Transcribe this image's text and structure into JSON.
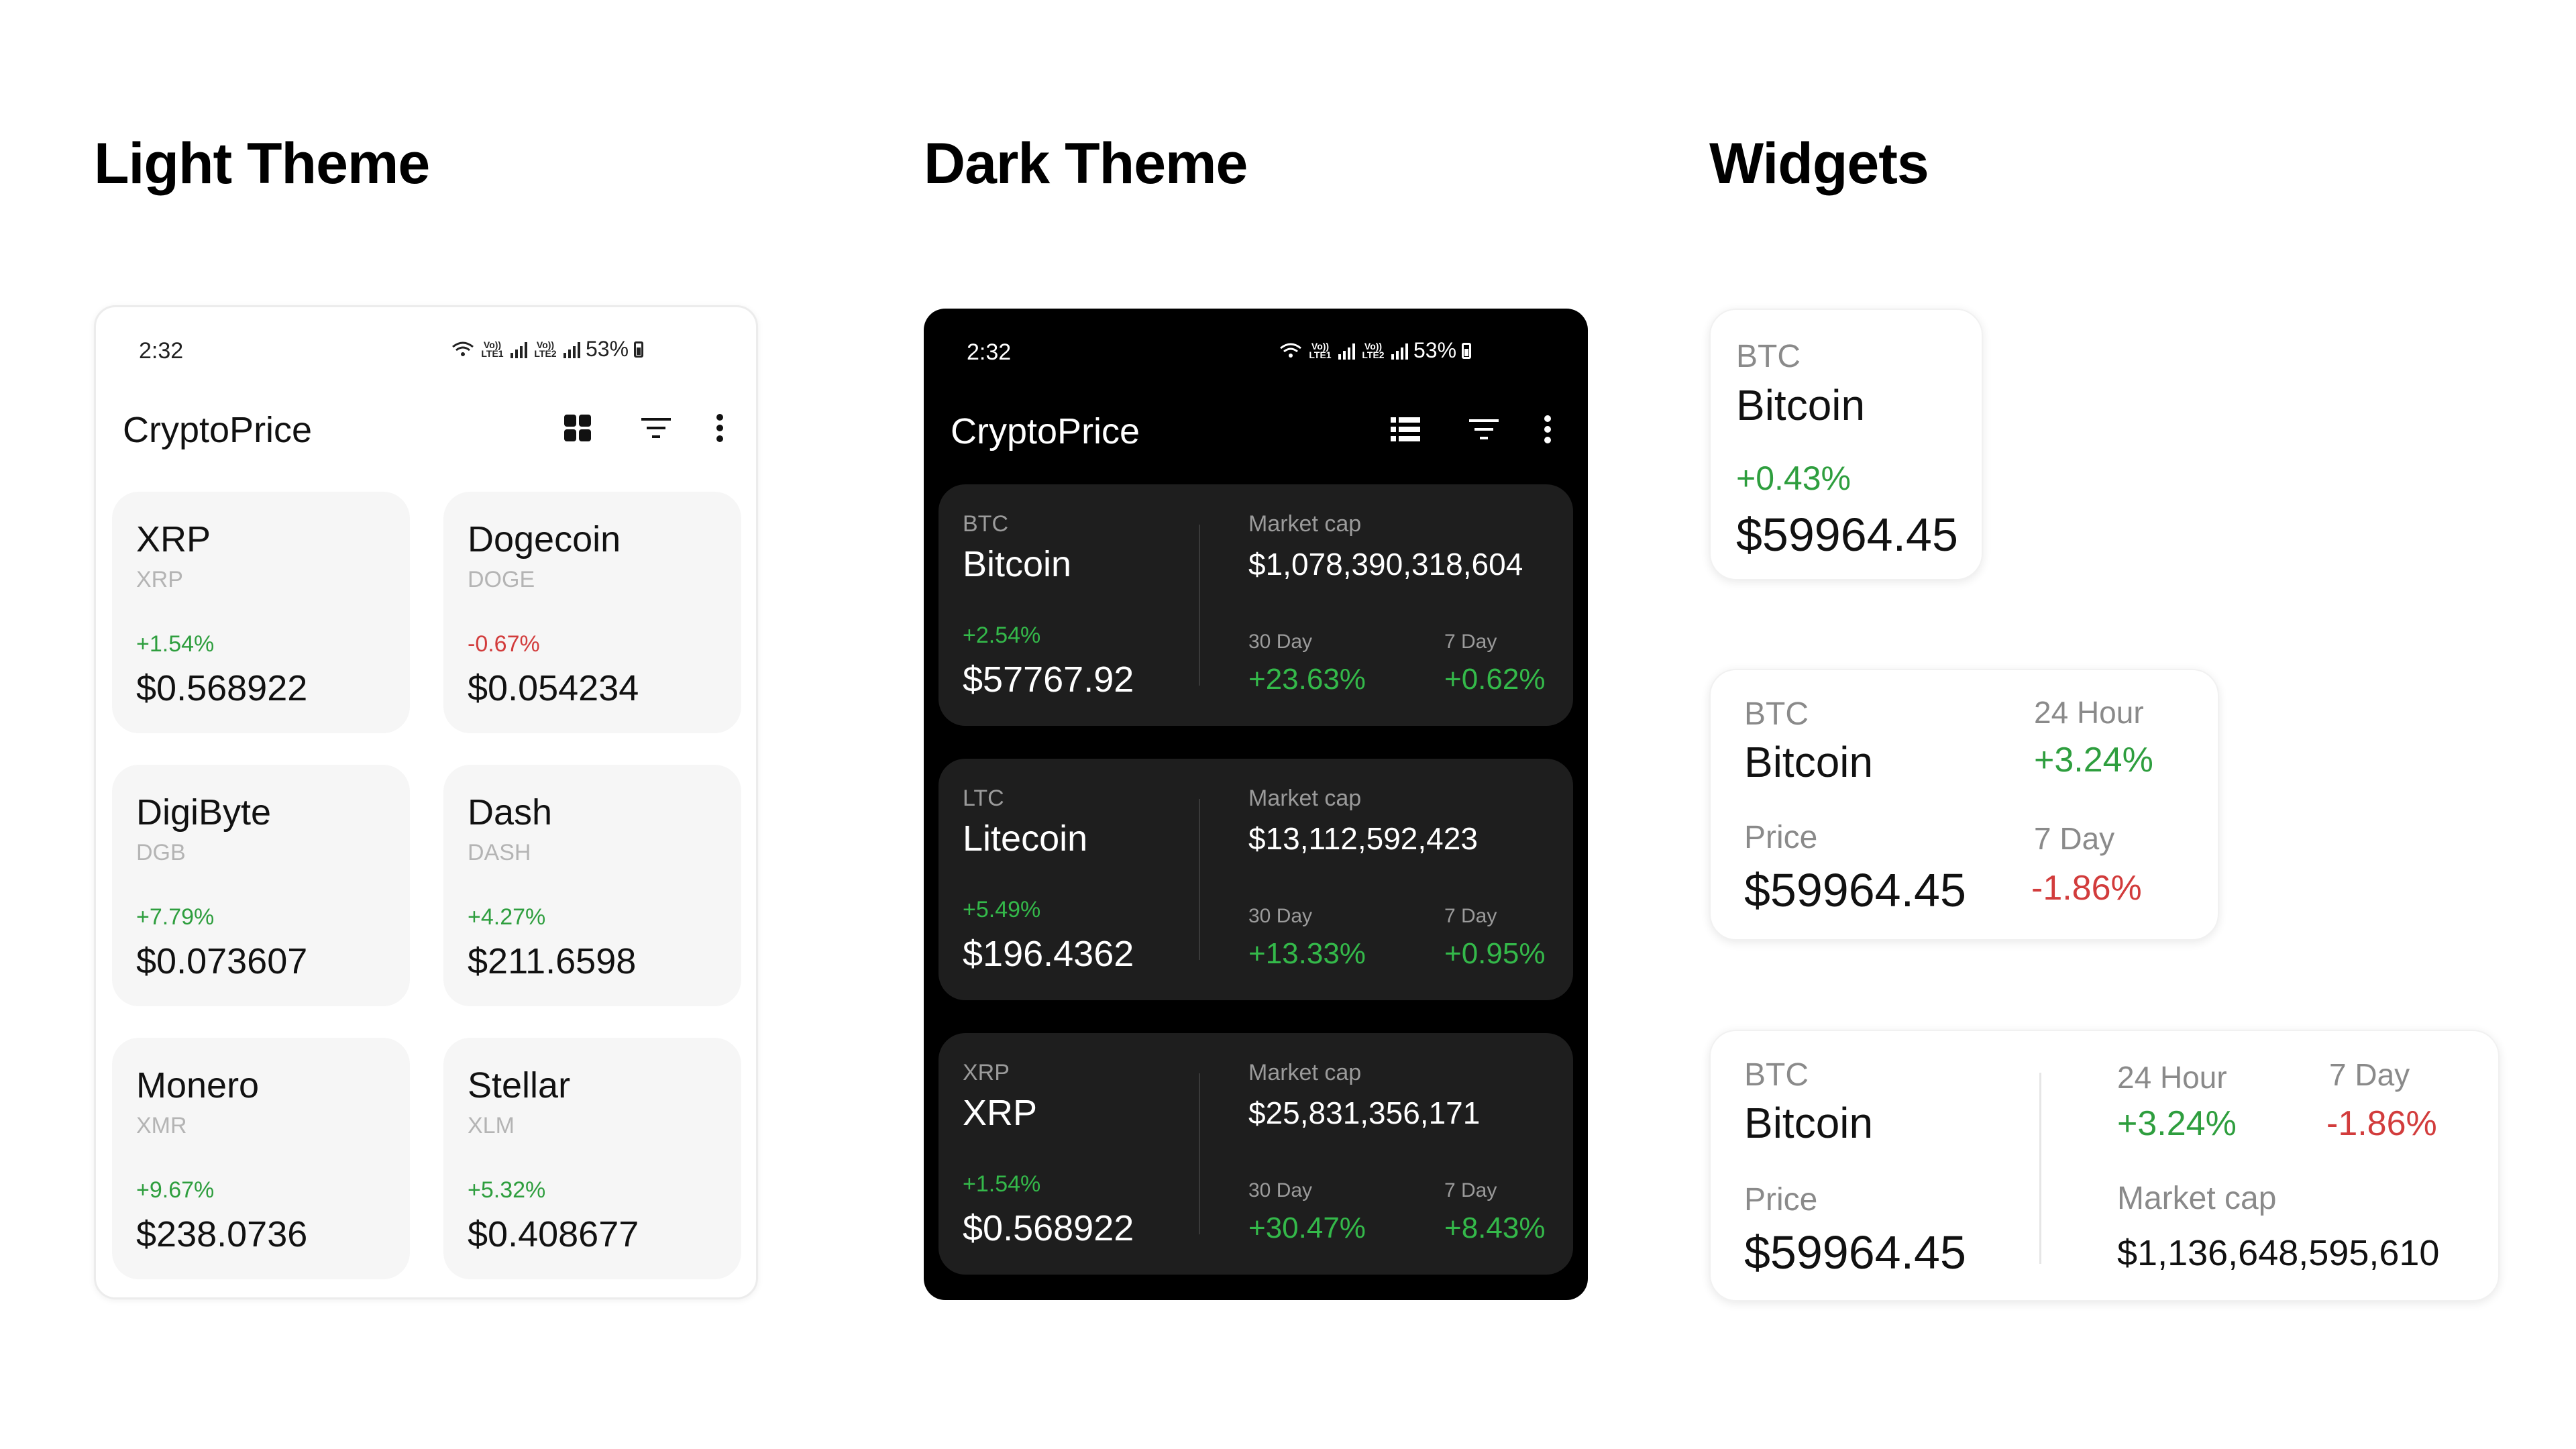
{
  "sections": {
    "light": "Light Theme",
    "dark": "Dark Theme",
    "widgets": "Widgets"
  },
  "status": {
    "time": "2:32",
    "battery": "53%",
    "net1": "Vo)) LTE1",
    "net2": "Vo)) LTE2"
  },
  "app": {
    "title": "CryptoPrice"
  },
  "icons": {
    "grid_view": "grid-view-icon",
    "list_view": "list-view-icon",
    "filter": "filter-icon",
    "more": "more-vert-icon"
  },
  "colors": {
    "positive": "#2e9e3e",
    "negative": "#d23c3c",
    "dark_bg": "#000000",
    "dark_card": "#1e1e1e",
    "light_card": "#f6f6f6"
  },
  "light_coins": [
    {
      "name": "XRP",
      "symbol": "XRP",
      "change": "+1.54%",
      "price": "$0.568922",
      "direction": "up"
    },
    {
      "name": "Dogecoin",
      "symbol": "DOGE",
      "change": "-0.67%",
      "price": "$0.054234",
      "direction": "down"
    },
    {
      "name": "DigiByte",
      "symbol": "DGB",
      "change": "+7.79%",
      "price": "$0.073607",
      "direction": "up"
    },
    {
      "name": "Dash",
      "symbol": "DASH",
      "change": "+4.27%",
      "price": "$211.6598",
      "direction": "up"
    },
    {
      "name": "Monero",
      "symbol": "XMR",
      "change": "+9.67%",
      "price": "$238.0736",
      "direction": "up"
    },
    {
      "name": "Stellar",
      "symbol": "XLM",
      "change": "+5.32%",
      "price": "$0.408677",
      "direction": "up"
    }
  ],
  "dark_coins": [
    {
      "symbol": "BTC",
      "name": "Bitcoin",
      "change": "+2.54%",
      "price": "$57767.92",
      "market_cap_label": "Market cap",
      "market_cap": "$1,078,390,318,604",
      "d30_label": "30 Day",
      "d30": "+23.63%",
      "d7_label": "7 Day",
      "d7": "+0.62%"
    },
    {
      "symbol": "LTC",
      "name": "Litecoin",
      "change": "+5.49%",
      "price": "$196.4362",
      "market_cap_label": "Market cap",
      "market_cap": "$13,112,592,423",
      "d30_label": "30 Day",
      "d30": "+13.33%",
      "d7_label": "7 Day",
      "d7": "+0.95%"
    },
    {
      "symbol": "XRP",
      "name": "XRP",
      "change": "+1.54%",
      "price": "$0.568922",
      "market_cap_label": "Market cap",
      "market_cap": "$25,831,356,171",
      "d30_label": "30 Day",
      "d30": "+30.47%",
      "d7_label": "7 Day",
      "d7": "+8.43%"
    }
  ],
  "widgets": {
    "small": {
      "symbol": "BTC",
      "name": "Bitcoin",
      "change": "+0.43%",
      "price": "$59964.45"
    },
    "medium": {
      "symbol": "BTC",
      "name": "Bitcoin",
      "price_label": "Price",
      "price": "$59964.45",
      "h24_label": "24 Hour",
      "h24": "+3.24%",
      "d7_label": "7 Day",
      "d7": "-1.86%"
    },
    "large": {
      "symbol": "BTC",
      "name": "Bitcoin",
      "price_label": "Price",
      "price": "$59964.45",
      "h24_label": "24 Hour",
      "h24": "+3.24%",
      "d7_label": "7 Day",
      "d7": "-1.86%",
      "market_cap_label": "Market cap",
      "market_cap": "$1,136,648,595,610"
    }
  }
}
